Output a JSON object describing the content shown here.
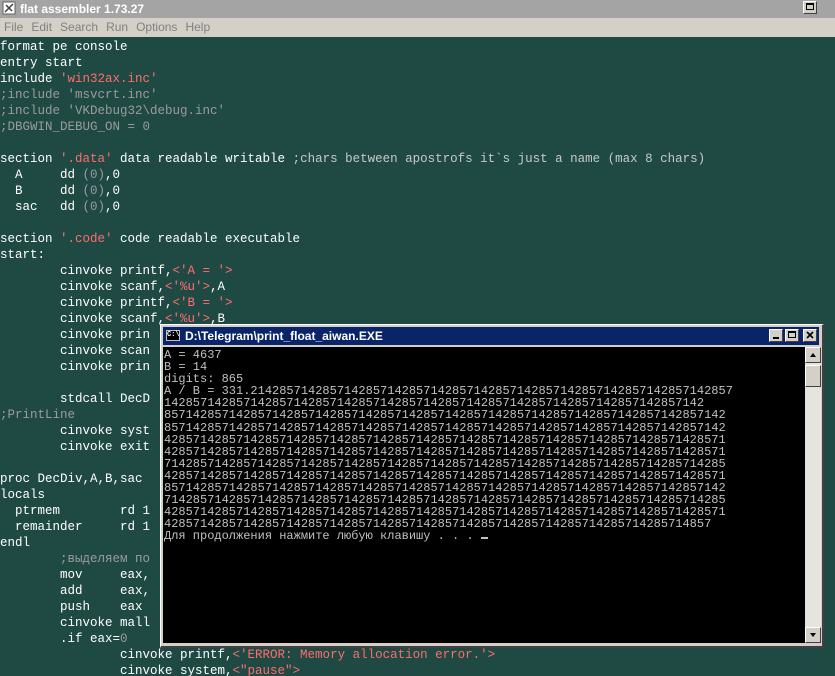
{
  "app": {
    "title": "flat assembler 1.73.27",
    "menu": [
      "File",
      "Edit",
      "Search",
      "Run",
      "Options",
      "Help"
    ]
  },
  "editor": {
    "lines": [
      [
        {
          "t": "format pe console",
          "c": "w"
        }
      ],
      [
        {
          "t": "entry start",
          "c": "w"
        }
      ],
      [
        {
          "t": "include ",
          "c": "w"
        },
        {
          "t": "'win32ax.inc'",
          "c": "s"
        }
      ],
      [
        {
          "t": ";include 'msvcrt.inc'",
          "c": "g"
        }
      ],
      [
        {
          "t": ";include 'VKDebug32\\debug.inc'",
          "c": "g"
        }
      ],
      [
        {
          "t": ";DBGWIN_DEBUG_ON = 0",
          "c": "g"
        }
      ],
      [
        {
          "t": "",
          "c": "w"
        }
      ],
      [
        {
          "t": "section ",
          "c": "w"
        },
        {
          "t": "'.data'",
          "c": "s"
        },
        {
          "t": " data readable writable ",
          "c": "w"
        },
        {
          "t": ";chars between apostrofs it`s just a name (max 8 chars)",
          "c": "c"
        }
      ],
      [
        {
          "t": "  A     dd ",
          "c": "w"
        },
        {
          "t": "(0)",
          "c": "g"
        },
        {
          "t": ",0",
          "c": "w"
        }
      ],
      [
        {
          "t": "  B     dd ",
          "c": "w"
        },
        {
          "t": "(0)",
          "c": "g"
        },
        {
          "t": ",0",
          "c": "w"
        }
      ],
      [
        {
          "t": "  sac   dd ",
          "c": "w"
        },
        {
          "t": "(0)",
          "c": "g"
        },
        {
          "t": ",0",
          "c": "w"
        }
      ],
      [
        {
          "t": "",
          "c": "w"
        }
      ],
      [
        {
          "t": "section ",
          "c": "w"
        },
        {
          "t": "'.code'",
          "c": "s"
        },
        {
          "t": " code readable executable",
          "c": "w"
        }
      ],
      [
        {
          "t": "start:",
          "c": "w"
        }
      ],
      [
        {
          "t": "        cinvoke printf,",
          "c": "w"
        },
        {
          "t": "<'A = '>",
          "c": "s"
        }
      ],
      [
        {
          "t": "        cinvoke scanf,",
          "c": "w"
        },
        {
          "t": "<'%u'>",
          "c": "s"
        },
        {
          "t": ",A",
          "c": "w"
        }
      ],
      [
        {
          "t": "        cinvoke printf,",
          "c": "w"
        },
        {
          "t": "<'B = '>",
          "c": "s"
        }
      ],
      [
        {
          "t": "        cinvoke scanf,",
          "c": "w"
        },
        {
          "t": "<'%u'>",
          "c": "s"
        },
        {
          "t": ",B",
          "c": "w"
        }
      ],
      [
        {
          "t": "        cinvoke prin",
          "c": "w"
        }
      ],
      [
        {
          "t": "        cinvoke scan",
          "c": "w"
        }
      ],
      [
        {
          "t": "        cinvoke prin",
          "c": "w"
        }
      ],
      [
        {
          "t": "",
          "c": "w"
        }
      ],
      [
        {
          "t": "        stdcall DecD",
          "c": "w"
        }
      ],
      [
        {
          "t": ";PrintLine",
          "c": "g"
        }
      ],
      [
        {
          "t": "        cinvoke syst",
          "c": "w"
        }
      ],
      [
        {
          "t": "        cinvoke exit",
          "c": "w"
        }
      ],
      [
        {
          "t": "",
          "c": "w"
        }
      ],
      [
        {
          "t": "proc DecDiv,A,B,sac",
          "c": "w"
        }
      ],
      [
        {
          "t": "locals",
          "c": "w"
        }
      ],
      [
        {
          "t": "  ptrmem        rd 1",
          "c": "w"
        }
      ],
      [
        {
          "t": "  remainder     rd 1",
          "c": "w"
        }
      ],
      [
        {
          "t": "endl",
          "c": "w"
        }
      ],
      [
        {
          "t": "        ;выделяем по",
          "c": "g"
        }
      ],
      [
        {
          "t": "        mov     eax,",
          "c": "w"
        }
      ],
      [
        {
          "t": "        add     eax,",
          "c": "w"
        }
      ],
      [
        {
          "t": "        push    eax",
          "c": "w"
        }
      ],
      [
        {
          "t": "        cinvoke mall",
          "c": "w"
        }
      ],
      [
        {
          "t": "        .if eax=",
          "c": "w"
        },
        {
          "t": "0",
          "c": "g"
        }
      ],
      [
        {
          "t": "                cinvoke printf,",
          "c": "w"
        },
        {
          "t": "<'ERROR: Memory allocation error.'>",
          "c": "s"
        }
      ],
      [
        {
          "t": "                cinvoke system,",
          "c": "w"
        },
        {
          "t": "<\"pause\">",
          "c": "s"
        }
      ]
    ]
  },
  "console": {
    "title": "D:\\Telegram\\print_float_aiwan.EXE",
    "icon_label": "C:\\",
    "lines": [
      "A = 4637",
      "B = 14",
      "digits: 865",
      "A / B = 331.2142857142857142857142857142857142857142857142857142857142857142857",
      "142857142857142857142857142857142857142857142857142857142857142857142857142",
      "857142857142857142857142857142857142857142857142857142857142857142857142857142",
      "857142857142857142857142857142857142857142857142857142857142857142857142857142",
      "428571428571428571428571428571428571428571428571428571428571428571428571428571",
      "428571428571428571428571428571428571428571428571428571428571428571428571428571",
      "714285714285714285714285714285714285714285714285714285714285714285714285714285",
      "428571428571428571428571428571428571428571428571428571428571428571428571428571",
      "857142857142857142857142857142857142857142857142857142857142857142857142857142",
      "714285714285714285714285714285714285714285714285714285714285714285714285714285",
      "428571428571428571428571428571428571428571428571428571428571428571428571428571",
      "4285714285714285714285714285714285714285714285714285714285714285714285714857",
      "Для продолжения нажмите любую клавишу . . . "
    ]
  }
}
